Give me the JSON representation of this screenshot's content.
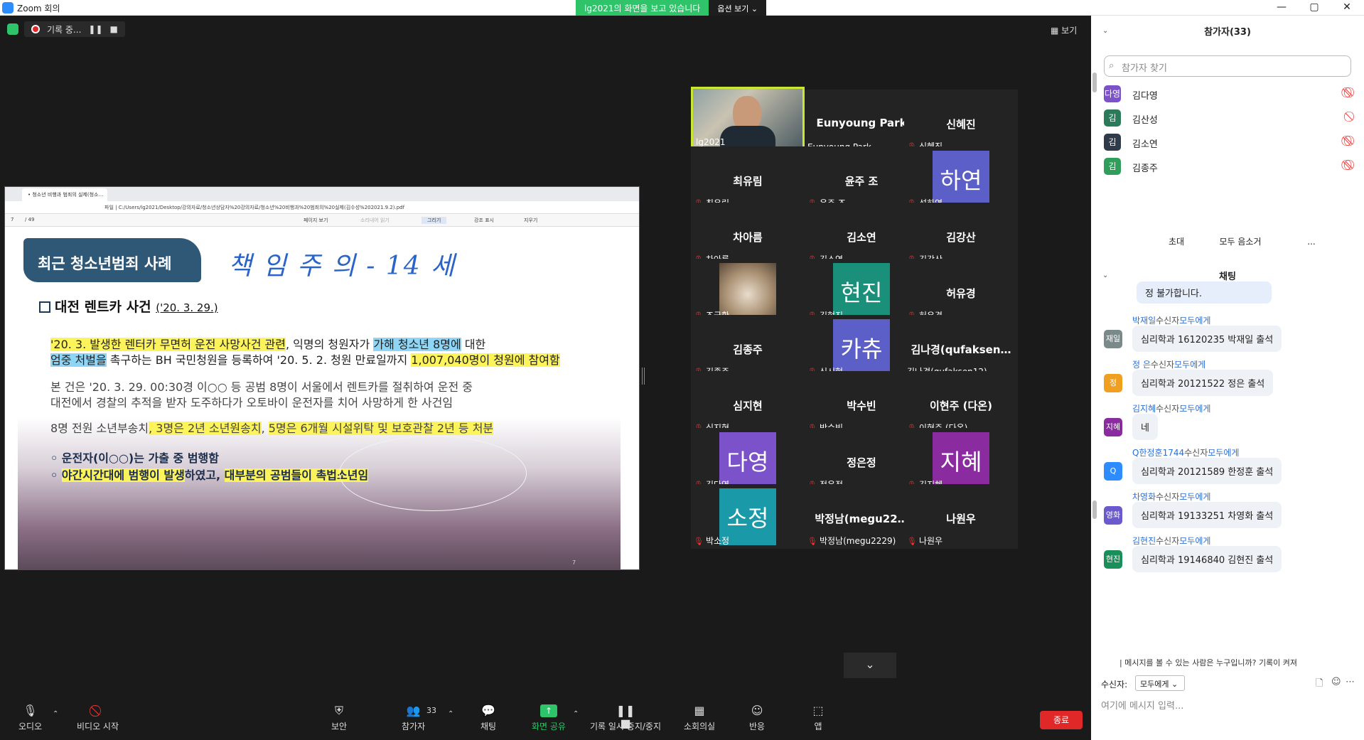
{
  "window": {
    "title": "Zoom 회의",
    "minimize": "—",
    "maximize": "▢",
    "close": "✕"
  },
  "share_banner": {
    "text": "lg2021의 화면을 보고 있습니다",
    "options": "옵션 보기 ⌄"
  },
  "recording": {
    "label": "기록 중...",
    "pause": "❚❚",
    "stop": "■"
  },
  "view_button": "보기",
  "shared_screen": {
    "tab_title": "• 청소년 비행과 범죄의 실제(청소…",
    "url": "파일 | C:/Users/lg2021/Desktop/강의자료/청소년상담자%20강의자료/청소년%20비행과%20범죄의%20실제(김수성%202021.9.2).pdf",
    "toolbar_page": "7",
    "toolbar_zoom": "/ 49",
    "toolbar_items": [
      "페이지 보기",
      "소리내어 읽기",
      "그리기",
      "강조 표시",
      "지우기"
    ],
    "slide": {
      "title": "최근 청소년범죄 사례",
      "handwriting": "책 임 주 의 - 14 세",
      "case_title": "대전 렌트카 사건",
      "case_date": "('20. 3. 29.)",
      "para1_line1_a": "'20. 3. 발생한 렌터카 무면허 운전 사망사건 관련",
      "para1_line1_b": ", 익명의 청원자가 ",
      "para1_line1_c": "가해 청소년 8명에",
      "para1_line1_d": " 대한",
      "para1_line2_a": "엄중 처벌을",
      "para1_line2_b": " 촉구하는 BH 국민청원을 등록하여  '20. 5. 2. 청원 만료일까지 ",
      "para1_line2_c": "1,007,040명이 청원에 참여함",
      "para2_line1": "본 건은 '20. 3. 29. 00:30경 이○○ 등 공범 8명이 서울에서 렌트카를 절취하여 운전 중",
      "para2_line2": "대전에서 경찰의 추적을 받자 도주하다가 오토바이 운전자를 치어 사망하게 한 사건임",
      "para3_a": "8명 전원 소년부송치",
      "para3_b": ", 3명은 2년 소년원송치",
      "para3_c": ", ",
      "para3_d": "5명은 6개월 시설위탁 및 보호관찰 2년 등 처분",
      "bullet1": "◦ 운전자(이○○)는 가출 중 범행함",
      "bullet2_a": "야간시간대에 범행이 발생",
      "bullet2_b": "하였고, ",
      "bullet2_c": "대부분의 공범들이 촉법소년임",
      "page_number": "7"
    }
  },
  "video_tiles": [
    {
      "name": "",
      "label": "lg2021",
      "video": "person",
      "muted": false
    },
    {
      "name": "Eunyoung Park",
      "label": "Eunyoung Park",
      "muted": false
    },
    {
      "name": "신혜진",
      "label": "신혜진",
      "muted": true
    },
    {
      "name": "최유림",
      "label": "최유림",
      "muted": true
    },
    {
      "name": "윤주 조",
      "label": "윤주 조",
      "muted": true
    },
    {
      "name": "하연",
      "label": "성하연",
      "avatar_color": "#5b5fc7",
      "muted": true
    },
    {
      "name": "차아름",
      "label": "차아름",
      "muted": true
    },
    {
      "name": "김소연",
      "label": "김소연",
      "muted": true
    },
    {
      "name": "김강산",
      "label": "김강산",
      "muted": true
    },
    {
      "name": "",
      "label": "조국환",
      "video": "cat",
      "muted": true
    },
    {
      "name": "현진",
      "label": "김현진",
      "avatar_color": "#1a8f7a",
      "muted": true
    },
    {
      "name": "허유경",
      "label": "허유경",
      "muted": true
    },
    {
      "name": "김종주",
      "label": "김종주",
      "muted": true
    },
    {
      "name": "카츄",
      "label": "신시현",
      "avatar_color": "#5b5fc7",
      "muted": true
    },
    {
      "name": "김나경(qufaksen…",
      "label": "김나경(qufaksen12)",
      "muted": false
    },
    {
      "name": "심지현",
      "label": "심지현",
      "muted": true
    },
    {
      "name": "박수빈",
      "label": "박수빈",
      "muted": true
    },
    {
      "name": "이현주 (다온)",
      "label": "이현주 (다온)",
      "muted": true
    },
    {
      "name": "다영",
      "label": "김다영",
      "avatar_color": "#7b52c9",
      "muted": true
    },
    {
      "name": "정은정",
      "label": "정은정",
      "muted": true
    },
    {
      "name": "지혜",
      "label": "김지혜",
      "avatar_color": "#8a2ba0",
      "muted": true
    },
    {
      "name": "소정",
      "label": "박소정",
      "avatar_color": "#1a9aa8",
      "muted": true
    },
    {
      "name": "박정남(megu22…",
      "label": "박정남(megu2229)",
      "muted": true
    },
    {
      "name": "나원우",
      "label": "나원우",
      "muted": true
    }
  ],
  "more_button": "⌄",
  "toolbar": {
    "audio": "오디오",
    "video": "비디오 시작",
    "security": "보안",
    "participants": "참가자",
    "participants_count": "33",
    "chat": "채팅",
    "share": "화면 공유",
    "record": "기록 일시 중지/중지",
    "breakout": "소회의실",
    "reactions": "반응",
    "apps": "앱",
    "end": "종료"
  },
  "panel": {
    "participants_title": "참가자(33)",
    "search_placeholder": "참가자 찾기",
    "participants": [
      {
        "avatar": "다영",
        "color": "#7b52c9",
        "name": "김다영"
      },
      {
        "avatar": "김",
        "color": "#2b7a5a",
        "name": "김산성"
      },
      {
        "avatar": "김",
        "color": "#2f3a4a",
        "name": "김소연"
      },
      {
        "avatar": "김",
        "color": "#2f9e5a",
        "name": "김종주"
      }
    ],
    "invite": "초대",
    "mute_all": "모두 음소거",
    "more": "...",
    "chat_title": "채팅",
    "chat_top_bubble": "정 불가합니다.",
    "messages": [
      {
        "sender": "박재일",
        "avatar": "재일",
        "color": "#7a8a8a",
        "text": "심리학과 16120235 박재일 출석"
      },
      {
        "sender": "정 은",
        "avatar": "정",
        "color": "#f0a020",
        "text": "심리학과 20121522 정은 출석"
      },
      {
        "sender": "김지혜",
        "avatar": "지혜",
        "color": "#8a2ba0",
        "text": "네"
      },
      {
        "sender": "Q한정훈1744",
        "avatar": "Q",
        "color": "#2d8cff",
        "text": "심리학과 20121589 한정훈 출석"
      },
      {
        "sender": "차영화",
        "avatar": "영화",
        "color": "#6a5acd",
        "text": "심리학과 19133251 차영화 출석"
      },
      {
        "sender": "김현진",
        "avatar": "현진",
        "color": "#1a8f5a",
        "text": "심리학과 19146840 김현진 출석"
      }
    ],
    "to_label": "수신자",
    "to_everyone": "모두에게",
    "info_line": "| 메시지를 볼 수 있는 사람은 누구입니까? 기록이 켜져",
    "recipient_label": "수신자:",
    "recipient_value": "모두에게 ⌄",
    "input_placeholder": "여기에 메시지 입력..."
  }
}
